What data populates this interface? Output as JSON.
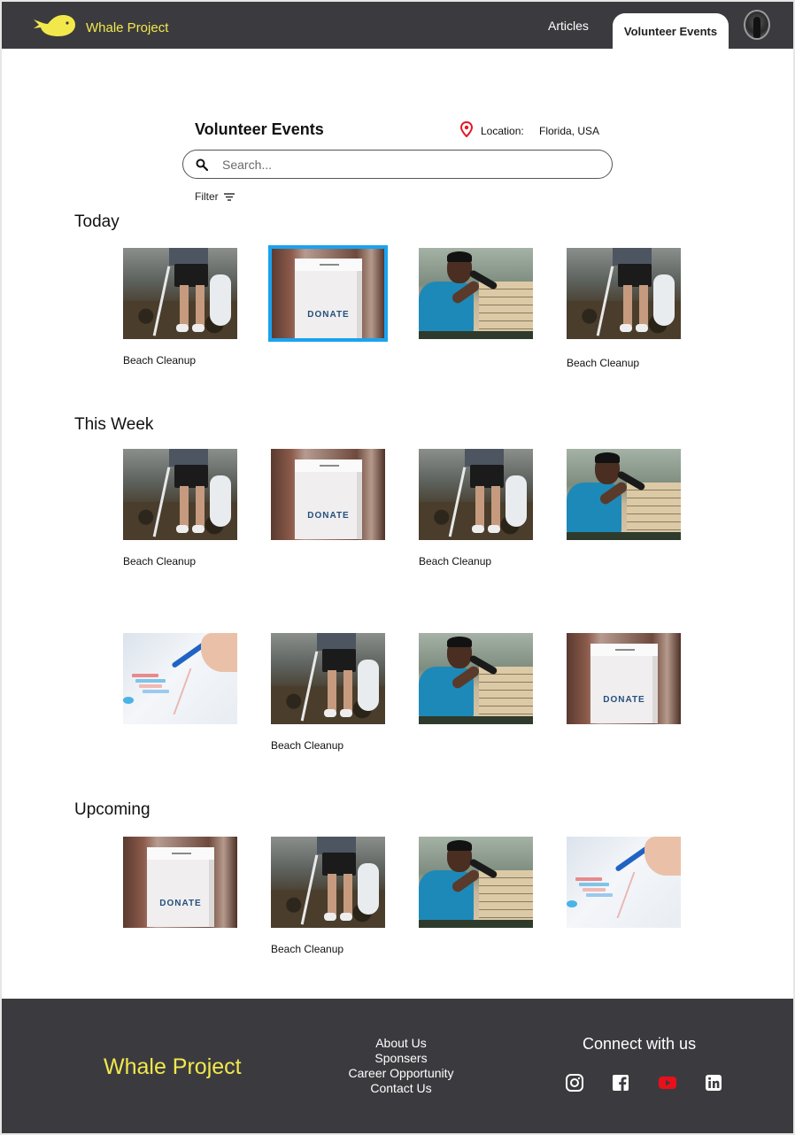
{
  "header": {
    "brand": "Whale Project",
    "nav": {
      "articles": "Articles",
      "volunteer_events": "Volunteer Events"
    },
    "accent_color": "#f2e84c"
  },
  "search_area": {
    "title": "Volunteer Events",
    "location_label": "Location:",
    "location_value": "Florida, USA",
    "search_placeholder": "Search...",
    "filter_label": "Filter"
  },
  "sections": [
    {
      "title": "Today",
      "cards": [
        {
          "image": "beach-cleanup",
          "caption": "Beach Cleanup"
        },
        {
          "image": "donate-box",
          "caption": "",
          "selected": true
        },
        {
          "image": "microphone-speaker",
          "caption": ""
        },
        {
          "image": "beach-cleanup",
          "caption": "Beach Cleanup"
        }
      ]
    },
    {
      "title": "This Week",
      "cards": [
        {
          "image": "beach-cleanup",
          "caption": "Beach Cleanup"
        },
        {
          "image": "donate-box",
          "caption": ""
        },
        {
          "image": "beach-cleanup",
          "caption": "Beach Cleanup"
        },
        {
          "image": "microphone-speaker",
          "caption": ""
        },
        {
          "image": "chart-analysis",
          "caption": ""
        },
        {
          "image": "beach-cleanup",
          "caption": "Beach Cleanup"
        },
        {
          "image": "microphone-speaker",
          "caption": ""
        },
        {
          "image": "donate-box",
          "caption": ""
        }
      ]
    },
    {
      "title": "Upcoming",
      "cards": [
        {
          "image": "donate-box",
          "caption": ""
        },
        {
          "image": "beach-cleanup",
          "caption": "Beach Cleanup"
        },
        {
          "image": "microphone-speaker",
          "caption": ""
        },
        {
          "image": "chart-analysis",
          "caption": ""
        }
      ]
    }
  ],
  "donate_box_text": "DONATE",
  "footer": {
    "brand": "Whale Project",
    "links": [
      "About Us",
      "Sponsers",
      "Career Opportunity",
      "Contact Us"
    ],
    "connect_title": "Connect with us",
    "social_icons": [
      "instagram-icon",
      "facebook-icon",
      "youtube-icon",
      "linkedin-icon"
    ],
    "youtube_color": "#e8101a"
  }
}
